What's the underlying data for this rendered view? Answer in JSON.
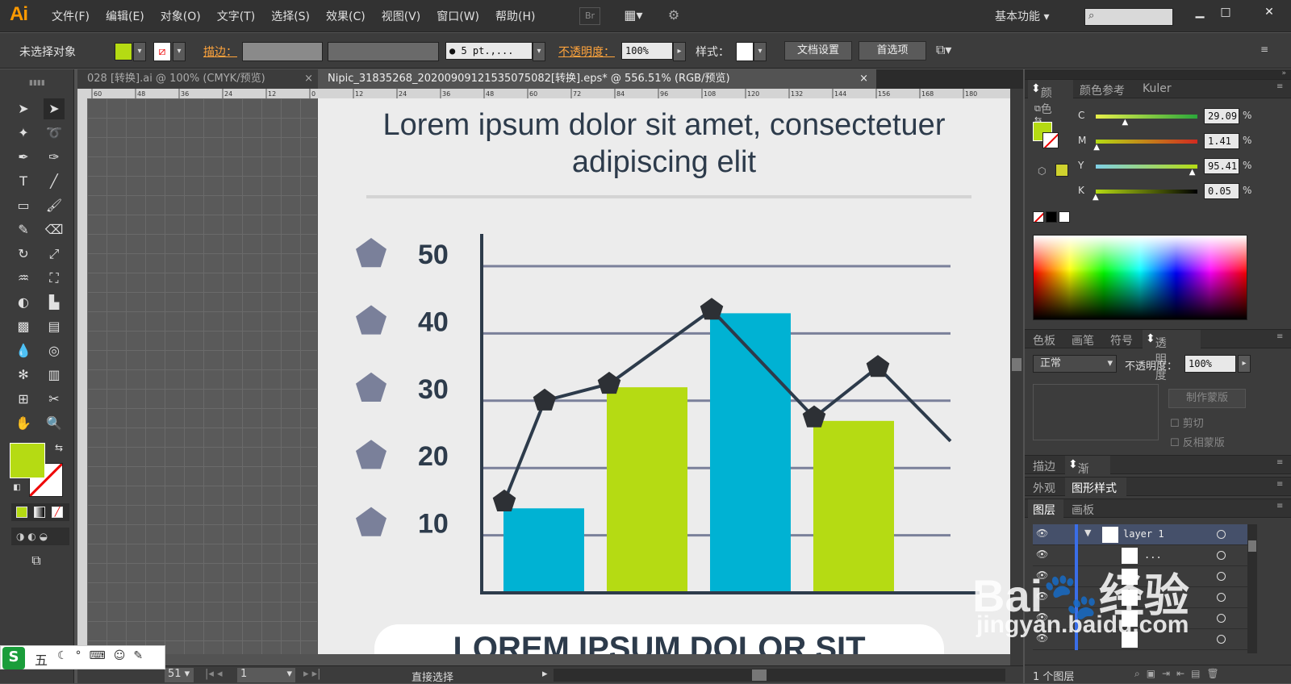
{
  "app": {
    "logo": "Ai"
  },
  "menu": [
    "文件(F)",
    "编辑(E)",
    "对象(O)",
    "文字(T)",
    "选择(S)",
    "效果(C)",
    "视图(V)",
    "窗口(W)",
    "帮助(H)"
  ],
  "menubar_icons": {
    "bridge": "Br",
    "arrange": "arrange-documents-icon",
    "gpu": "gpu-performance-icon"
  },
  "workspace": "基本功能",
  "search_icon": "search-icon",
  "window_buttons": {
    "minimize": "▁",
    "maximize": "□",
    "close": "✕"
  },
  "control_bar": {
    "selection_status": "未选择对象",
    "stroke_label": "描边：",
    "brush_value": "● 5 pt.,...",
    "opacity_label": "不透明度：",
    "opacity_value": "100%",
    "style_label": "样式：",
    "doc_setup_button": "文档设置",
    "preferences_button": "首选项",
    "fill_color": "#b5db13"
  },
  "doc_tabs": [
    {
      "label": "028 [转换].ai @ 100% (CMYK/预览)",
      "active": false
    },
    {
      "label": "Nipic_31835268_20200909121535075082[转换].eps* @ 556.51% (RGB/预览)",
      "active": true
    }
  ],
  "ruler_h": [
    "60",
    "48",
    "36",
    "24",
    "12",
    "0",
    "12",
    "24",
    "36",
    "48",
    "60",
    "72",
    "84",
    "96",
    "108",
    "120",
    "132",
    "144",
    "156",
    "168",
    "180"
  ],
  "artboard": {
    "title_line1": "Lorem ipsum dolor sit amet, consectetuer",
    "title_line2": "adipiscing elit",
    "bottom_banner": "LOREM IPSUM DOLOR SIT"
  },
  "chart_data": {
    "type": "bar",
    "y_ticks": [
      "50",
      "40",
      "30",
      "20",
      "10"
    ],
    "ylim": [
      0,
      50
    ],
    "bars": [
      {
        "value": 14,
        "color": "#00b2d3"
      },
      {
        "value": 32,
        "color": "#b5db13"
      },
      {
        "value": 43,
        "color": "#00b2d3"
      },
      {
        "value": 27,
        "color": "#b5db13"
      }
    ],
    "line_points": [
      15,
      30,
      32.5,
      43.5,
      27.5,
      35,
      24
    ],
    "line_color": "#2d3b4b",
    "grid_color": "#7a809a",
    "marker_color": "#7a809a"
  },
  "statusbar": {
    "zoom": "51",
    "artboard_num": "1",
    "tool": "直接选择"
  },
  "panels": {
    "color_tabs": [
      "颜色",
      "颜色参考",
      "Kuler"
    ],
    "cmyk": [
      {
        "label": "C",
        "value": "29.09",
        "pos": 0.29
      },
      {
        "label": "M",
        "value": "1.41",
        "pos": 0.01
      },
      {
        "label": "Y",
        "value": "95.41",
        "pos": 0.95
      },
      {
        "label": "K",
        "value": "0.05",
        "pos": 0.0
      }
    ],
    "percent": "%",
    "swatch_tabs": [
      "色板",
      "画笔",
      "符号",
      "透明度"
    ],
    "blend_mode": "正常",
    "transparency_opacity_label": "不透明度：",
    "transparency_opacity_value": "100%",
    "mask_button": "制作蒙版",
    "clip_label": "剪切",
    "invert_label": "反相蒙版",
    "stroke_tabs": [
      "描边",
      "渐变"
    ],
    "appearance_tabs": [
      "外观",
      "图形样式"
    ],
    "layer_tabs": [
      "图层",
      "画板"
    ],
    "layers": [
      {
        "name": "layer 1"
      },
      {
        "name": "..."
      },
      {
        "name": ""
      },
      {
        "name": ""
      },
      {
        "name": ""
      },
      {
        "name": ""
      }
    ],
    "layer_count": "1 个图层"
  },
  "taskbar": {
    "ime": "五",
    "items": [
      "moon-icon",
      "punctuation-icon",
      "keyboard-icon",
      "user-icon",
      "wrench-icon"
    ]
  },
  "watermark": {
    "brand": "Bai",
    "brand2": "经验",
    "url": "jingyan.baidu.com"
  }
}
